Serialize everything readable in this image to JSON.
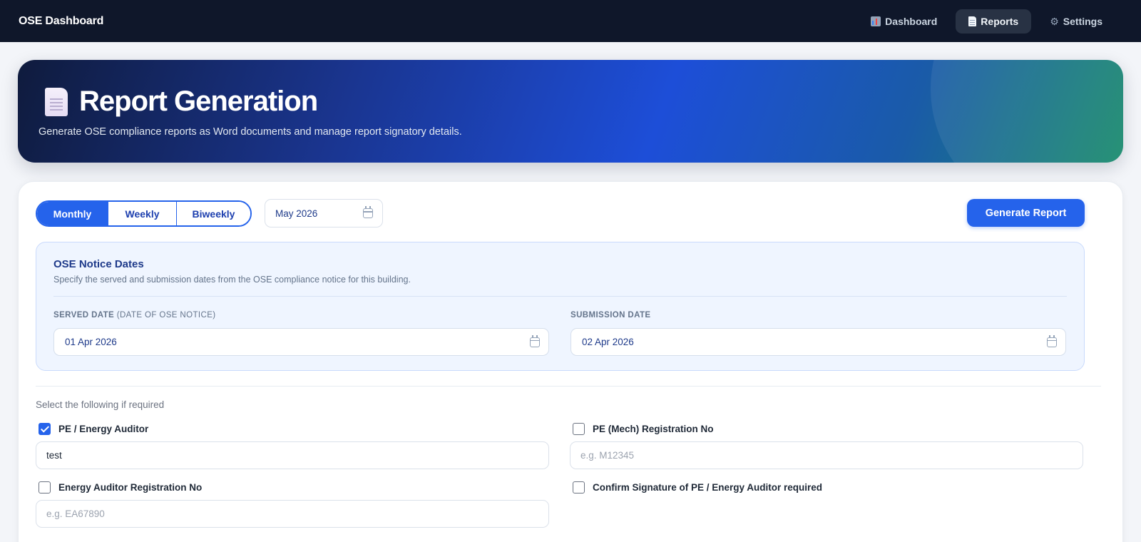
{
  "app": {
    "brand": "OSE Dashboard"
  },
  "nav": {
    "items": [
      {
        "label": "Dashboard",
        "icon": "bar-chart-icon",
        "active": false
      },
      {
        "label": "Reports",
        "icon": "document-icon",
        "active": true
      },
      {
        "label": "Settings",
        "icon": "gear-icon",
        "active": false
      }
    ]
  },
  "hero": {
    "title": "Report Generation",
    "subtitle": "Generate OSE compliance reports as Word documents and manage report signatory details."
  },
  "report": {
    "frequency_options": [
      "Monthly",
      "Weekly",
      "Biweekly"
    ],
    "selected_frequency": "Monthly",
    "period_value": "May 2026",
    "generate_label": "Generate Report"
  },
  "notice": {
    "title": "OSE Notice Dates",
    "description": "Specify the served and submission dates from the OSE compliance notice for this building.",
    "served_label": "SERVED DATE",
    "served_sublabel": "(DATE OF OSE NOTICE)",
    "served_value": "01 Apr 2026",
    "submission_label": "SUBMISSION DATE",
    "submission_value": "02 Apr 2026"
  },
  "options": {
    "note": "Select the following if required",
    "pe_auditor": {
      "label": "PE / Energy Auditor",
      "checked": true,
      "value": "test"
    },
    "pe_mech": {
      "label": "PE (Mech) Registration No",
      "checked": false,
      "placeholder": "e.g. M12345"
    },
    "ea_reg": {
      "label": "Energy Auditor Registration No",
      "checked": false,
      "placeholder": "e.g. EA67890"
    },
    "confirm_sig": {
      "label": "Confirm Signature of PE / Energy Auditor required",
      "checked": false
    }
  },
  "colors": {
    "topbar": "#0f172a",
    "accent": "#2563eb",
    "panel": "#eff5ff"
  }
}
